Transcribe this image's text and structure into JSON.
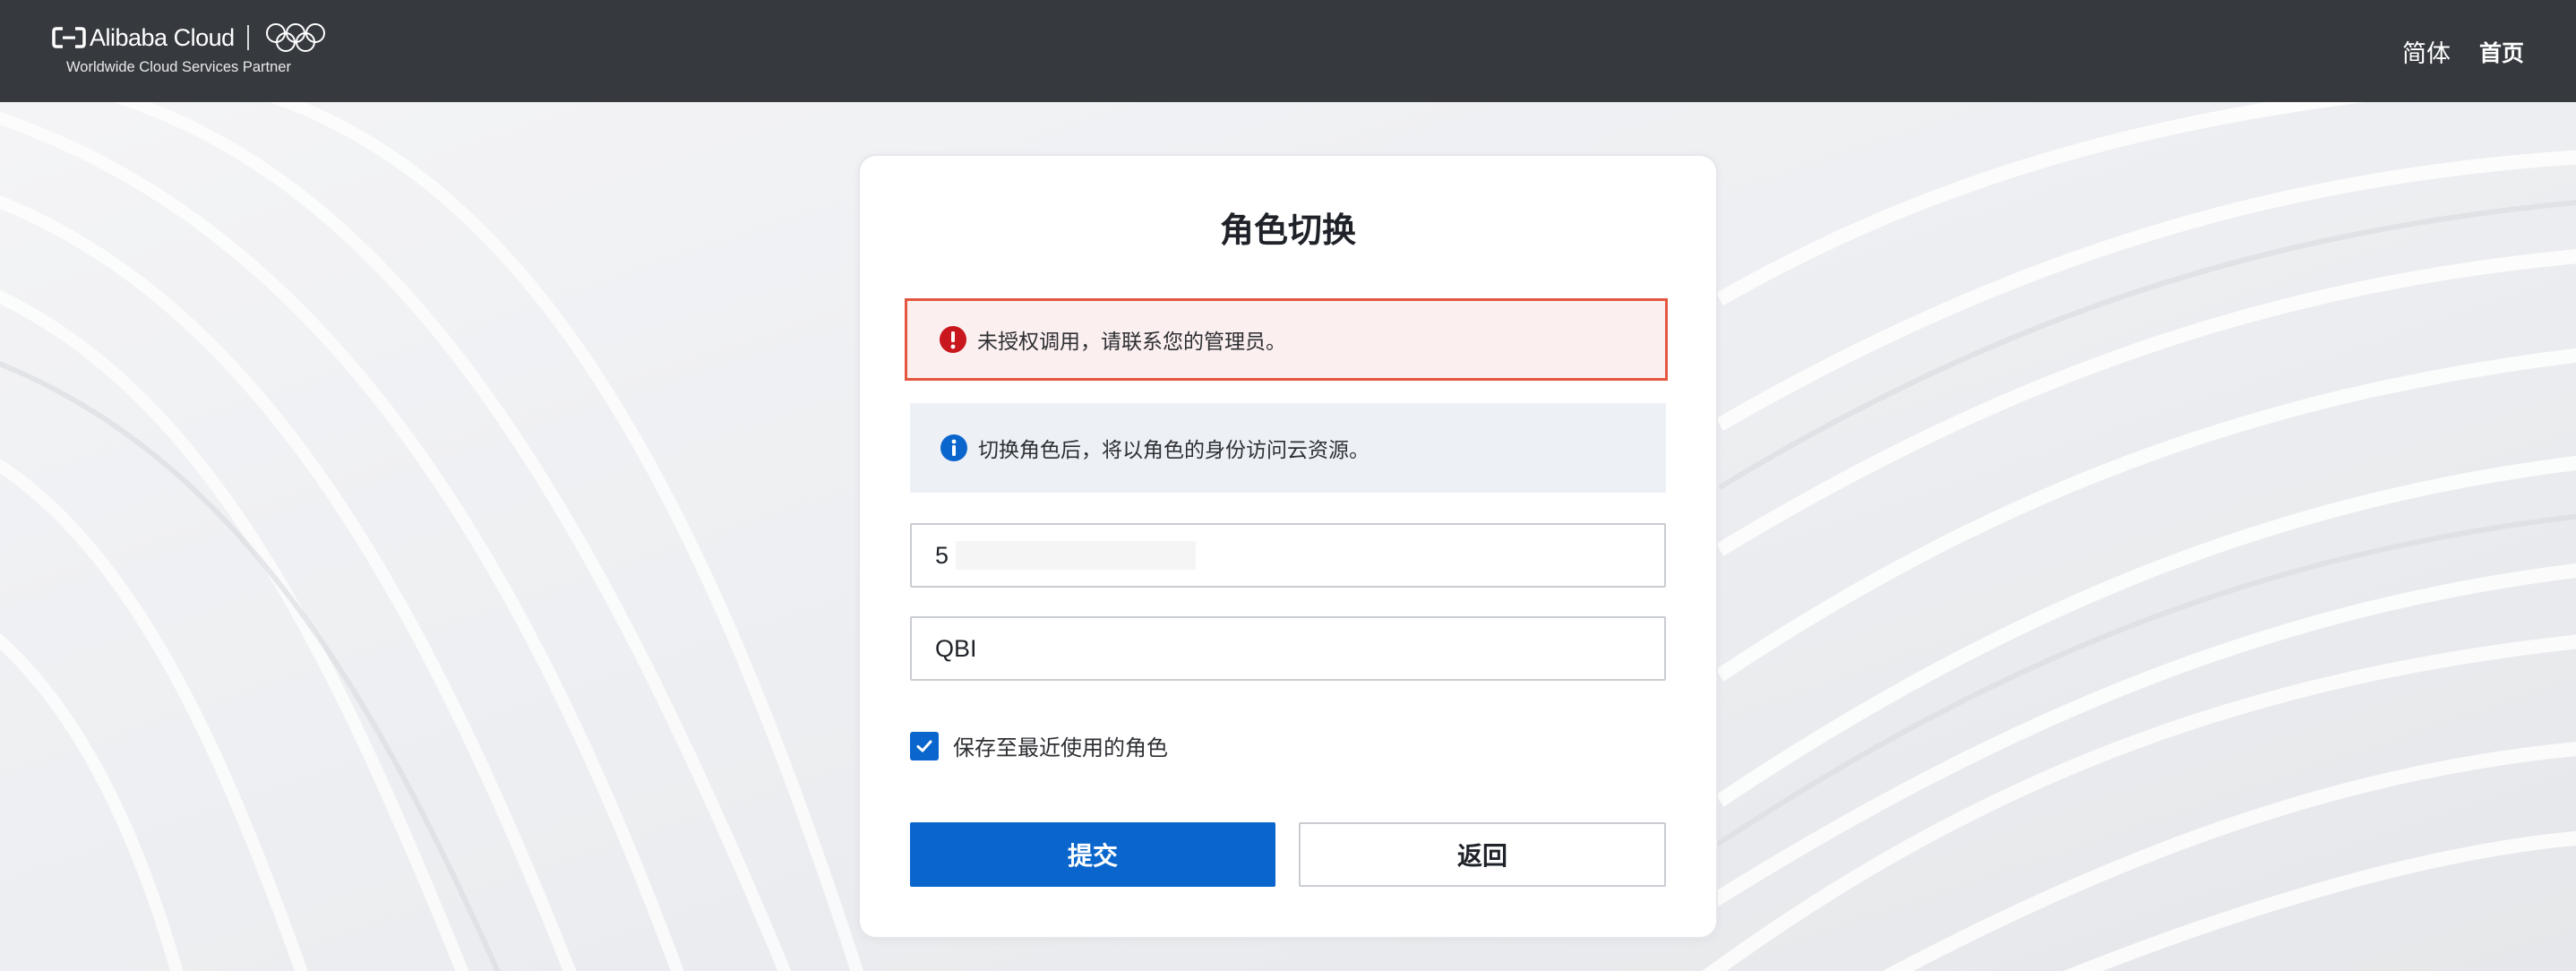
{
  "header": {
    "brand_name": "Alibaba Cloud",
    "tagline": "Worldwide Cloud Services Partner",
    "nav": [
      {
        "label": "简体"
      },
      {
        "label": "首页"
      }
    ],
    "background_color": "#363a3f"
  },
  "card": {
    "title": "角色切换",
    "error_alert": {
      "icon": "error-circle-icon",
      "text": "未授权调用，请联系您的管理员。",
      "color": "#e4563f"
    },
    "info_alert": {
      "icon": "info-circle-icon",
      "text": "切换角色后，将以角色的身份访问云资源。",
      "color": "#0a66cc"
    },
    "account_field": {
      "value": "5"
    },
    "role_field": {
      "value": "QBI"
    },
    "remember": {
      "label": "保存至最近使用的角色",
      "checked": true
    },
    "submit_label": "提交",
    "back_label": "返回"
  },
  "colors": {
    "primary": "#0a66cc",
    "error": "#e4563f"
  }
}
